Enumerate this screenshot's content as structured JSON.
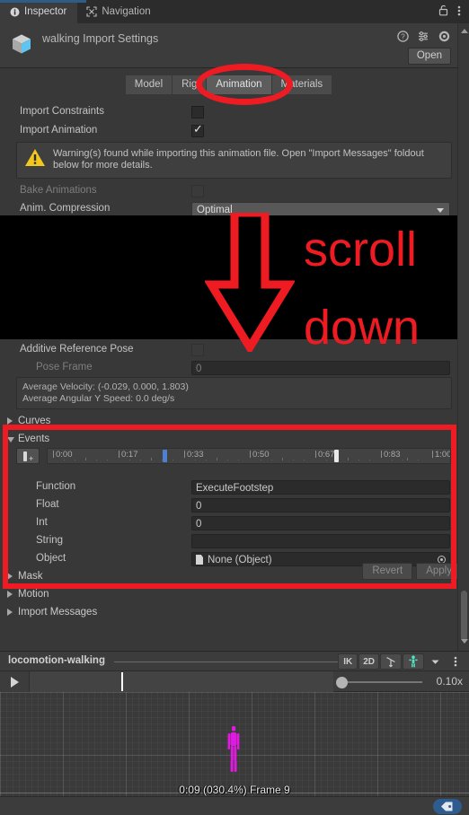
{
  "window_tabs": [
    {
      "label": "Inspector",
      "icon": "info-icon",
      "active": true
    },
    {
      "label": "Navigation",
      "icon": "navigation-icon",
      "active": false
    }
  ],
  "window_tab_right_icons": [
    "lock-icon",
    "kebab-menu-icon"
  ],
  "inspector": {
    "asset_title": "walking Import Settings",
    "asset_icon": "package-icon",
    "header_icons": [
      "help-icon",
      "preset-icon",
      "gear-icon"
    ],
    "open_button": "Open",
    "importer_tabs": [
      {
        "label": "Model",
        "active": false
      },
      {
        "label": "Rig",
        "active": false
      },
      {
        "label": "Animation",
        "active": true
      },
      {
        "label": "Materials",
        "active": false
      }
    ],
    "rows": {
      "import_constraints": {
        "label": "Import Constraints",
        "checked": false
      },
      "import_animation": {
        "label": "Import Animation",
        "checked": true
      },
      "bake_animations": {
        "label": "Bake Animations",
        "checked": false,
        "disabled": true
      },
      "anim_compression": {
        "label": "Anim. Compression",
        "value": "Optimal"
      },
      "additive_reference_pose": {
        "label": "Additive Reference Pose",
        "checked": false
      },
      "pose_frame": {
        "label": "Pose Frame",
        "value": "0",
        "disabled": true
      }
    },
    "warning": "Warning(s) found while importing this animation file. Open \"Import Messages\" foldout below for more details.",
    "info_lines": [
      "Average Velocity: (-0.029, 0.000, 1.803)",
      "Average Angular Y Speed: 0.0 deg/s"
    ],
    "foldouts": {
      "curves": {
        "label": "Curves",
        "open": false
      },
      "events": {
        "label": "Events",
        "open": true
      },
      "mask": {
        "label": "Mask",
        "open": false
      },
      "motion": {
        "label": "Motion",
        "open": false
      },
      "import_messages": {
        "label": "Import Messages",
        "open": false
      }
    },
    "events": {
      "add_event_button": "add-event-icon",
      "ruler_labels": [
        "0:00",
        "0:17",
        "0:33",
        "0:50",
        "0:67",
        "0:83",
        "1:00"
      ],
      "markers": [
        {
          "name": "selected-event-marker",
          "position_pct": 26.0,
          "selected": true
        },
        {
          "name": "event-marker",
          "position_pct": 71.5,
          "selected": false
        }
      ],
      "fields": [
        {
          "label": "Function",
          "value": "ExecuteFootstep",
          "type": "text"
        },
        {
          "label": "Float",
          "value": "0",
          "type": "text"
        },
        {
          "label": "Int",
          "value": "0",
          "type": "text"
        },
        {
          "label": "String",
          "value": "",
          "type": "text"
        },
        {
          "label": "Object",
          "value": "None (Object)",
          "type": "object"
        }
      ]
    },
    "revert_button": "Revert",
    "apply_button": "Apply"
  },
  "preview": {
    "clip_name": "locomotion-walking",
    "tools": [
      {
        "label": "IK",
        "name": "ik-toggle-button"
      },
      {
        "label": "2D",
        "name": "twod-toggle-button"
      },
      {
        "label": "",
        "name": "pivot-axis-icon"
      },
      {
        "label": "",
        "name": "avatar-icon"
      },
      {
        "label": "",
        "name": "avatar-dropdown-caret-icon"
      },
      {
        "label": "",
        "name": "kebab-menu-icon"
      }
    ],
    "play_button": "play-icon",
    "speed_value": "0.10x",
    "frame_readout": "0:09 (030.4%) Frame 9",
    "avatar_color": "#e119e1"
  },
  "status_bar": {
    "tag_icon": "tag-icon"
  },
  "annotations": {
    "scroll_line1": "scroll",
    "scroll_line2": "down",
    "arrow": "down-arrow-annotation",
    "ellipse": "animation-tab-highlight-ellipse",
    "rect": "events-section-highlight-rect",
    "color": "#ee1c22"
  }
}
